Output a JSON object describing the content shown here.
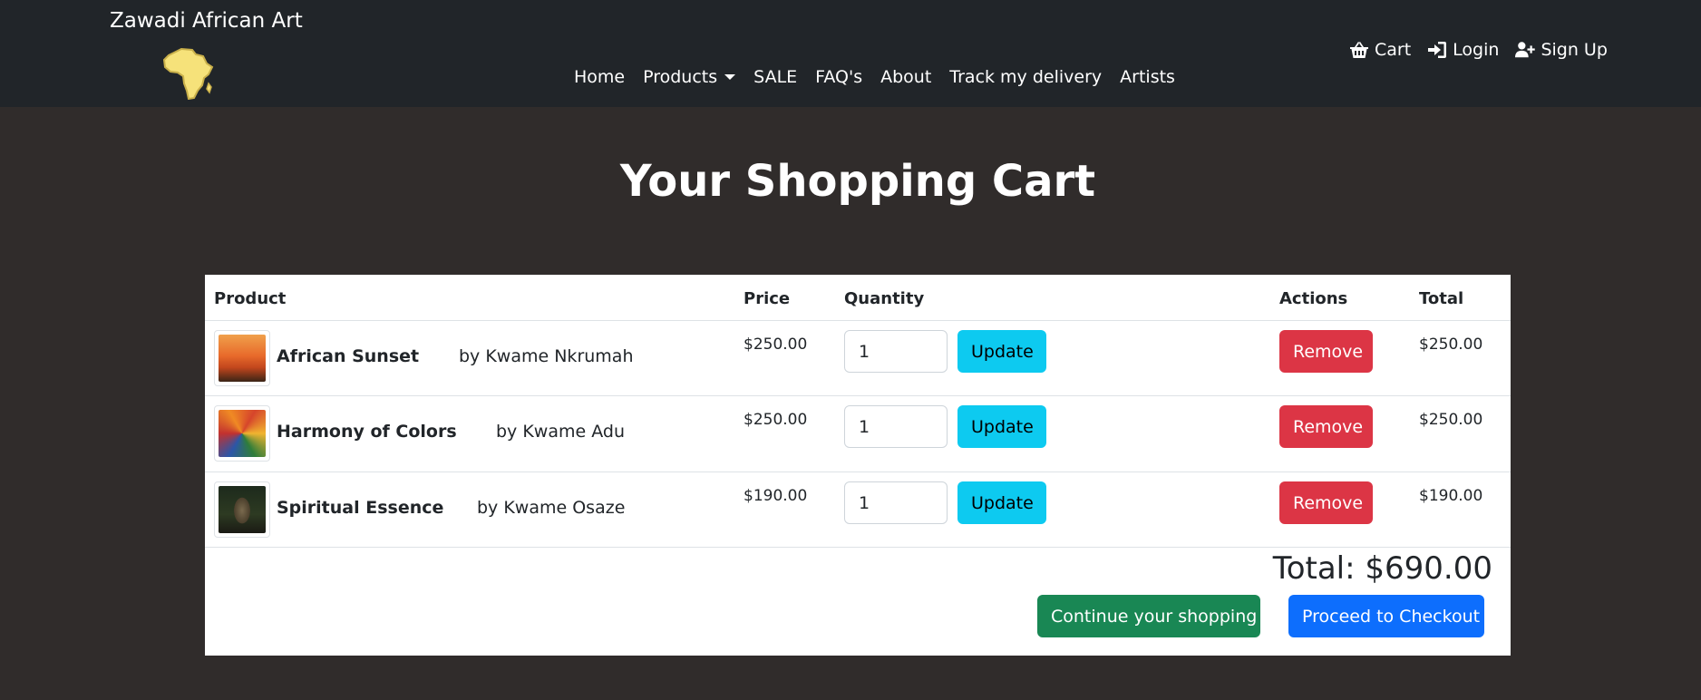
{
  "navbar": {
    "brand": "Zawadi African Art",
    "logo_icon": "africa-map-icon",
    "links": [
      {
        "label": "Home"
      },
      {
        "label": "Products",
        "dropdown": true
      },
      {
        "label": "SALE"
      },
      {
        "label": "FAQ's"
      },
      {
        "label": "About"
      },
      {
        "label": "Track my delivery"
      },
      {
        "label": "Artists"
      }
    ],
    "right": [
      {
        "label": "Cart",
        "icon": "basket-icon"
      },
      {
        "label": "Login",
        "icon": "login-icon"
      },
      {
        "label": "Sign Up",
        "icon": "user-plus-icon"
      }
    ]
  },
  "page": {
    "title": "Your Shopping Cart"
  },
  "cart": {
    "headers": {
      "product": "Product",
      "price": "Price",
      "quantity": "Quantity",
      "actions": "Actions",
      "total": "Total"
    },
    "items": [
      {
        "name": "African Sunset",
        "artist": "by Kwame Nkrumah",
        "price": "$250.00",
        "quantity": "1",
        "total": "$250.00",
        "thumb": "sunset-painting"
      },
      {
        "name": "Harmony of Colors",
        "artist": "by Kwame Adu",
        "price": "$250.00",
        "quantity": "1",
        "total": "$250.00",
        "thumb": "colorful-abstract-painting"
      },
      {
        "name": "Spiritual Essence",
        "artist": "by Kwame Osaze",
        "price": "$190.00",
        "quantity": "1",
        "total": "$190.00",
        "thumb": "carved-statue"
      }
    ],
    "update_label": "Update",
    "remove_label": "Remove",
    "grand_total": "Total: $690.00",
    "continue_label": "Continue your shopping",
    "checkout_label": "Proceed to Checkout"
  },
  "colors": {
    "navbar_bg": "#212529",
    "page_bg": "#302c2b",
    "update": "#0dcaf0",
    "remove": "#dc3545",
    "continue": "#198754",
    "checkout": "#0d6efd"
  }
}
